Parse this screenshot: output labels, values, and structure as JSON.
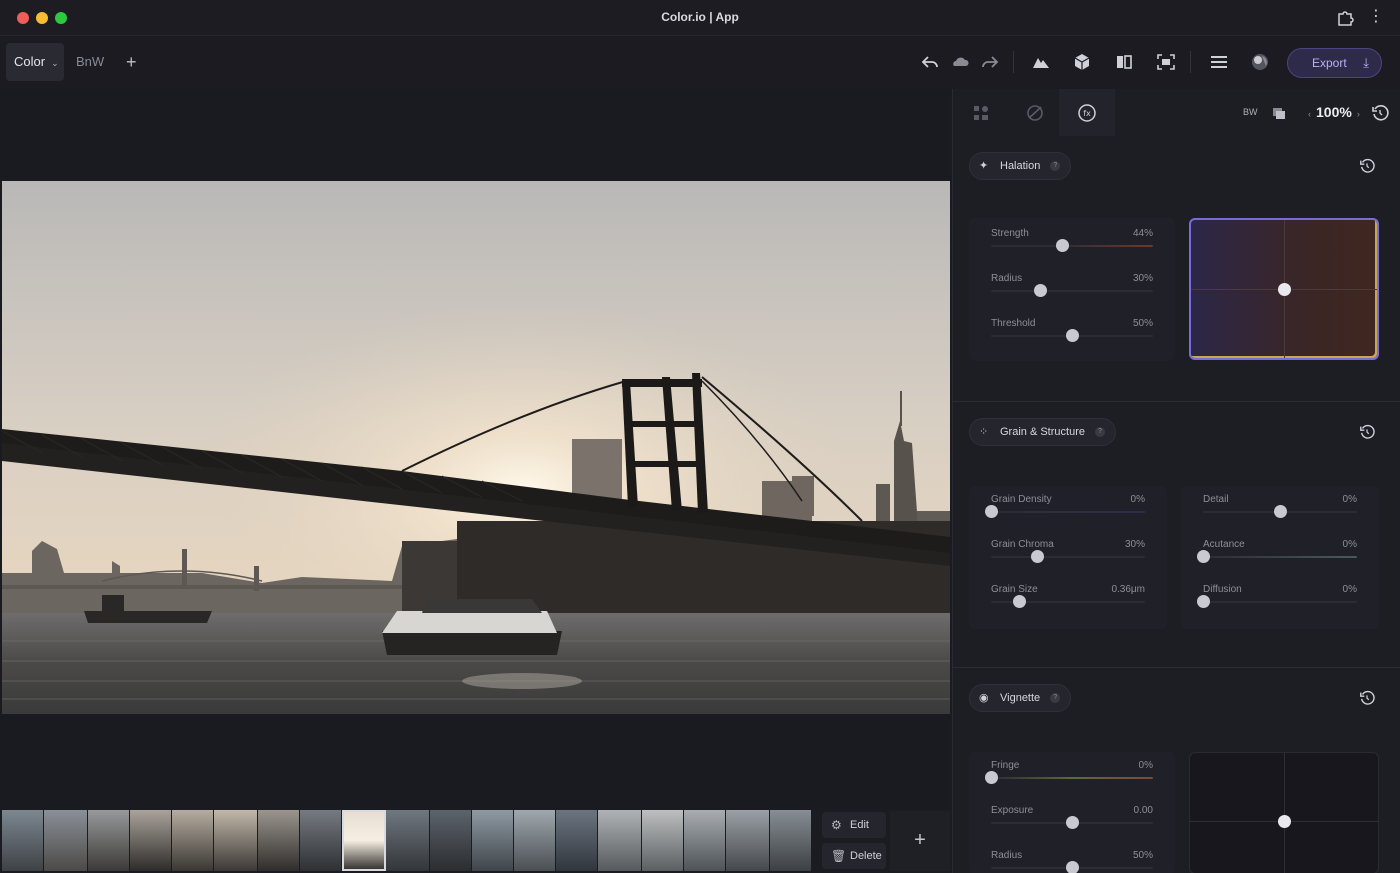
{
  "window": {
    "title": "Color.io | App"
  },
  "tabs": [
    {
      "label": "Color",
      "active": true
    },
    {
      "label": "BnW",
      "active": false
    }
  ],
  "toolbar": {
    "add_tab": "+",
    "export_label": "Export",
    "icons": [
      "undo-icon",
      "cloud-icon",
      "redo-icon",
      "histogram-icon",
      "cube-icon",
      "compare-icon",
      "fit-screen-icon",
      "menu-icon",
      "profile-icon"
    ]
  },
  "panel": {
    "bw_label": "BW",
    "zoom": "100%",
    "tabs": [
      "presets-icon",
      "curves-icon",
      "fx-icon"
    ],
    "sections": {
      "halation": {
        "title": "Halation",
        "help": "?",
        "sliders": [
          {
            "label": "Strength",
            "value_text": "44%",
            "value": 0.44
          },
          {
            "label": "Radius",
            "value_text": "30%",
            "value": 0.3
          },
          {
            "label": "Threshold",
            "value_text": "50%",
            "value": 0.5
          }
        ]
      },
      "grain": {
        "title": "Grain & Structure",
        "help": "?",
        "left_sliders": [
          {
            "label": "Grain Density",
            "value_text": "0%",
            "value": 0.0
          },
          {
            "label": "Grain Chroma",
            "value_text": "30%",
            "value": 0.3
          },
          {
            "label": "Grain Size",
            "value_text": "0.36μm",
            "value": 0.18
          }
        ],
        "right_sliders": [
          {
            "label": "Detail",
            "value_text": "0%",
            "value": 0.5
          },
          {
            "label": "Acutance",
            "value_text": "0%",
            "value": 0.0
          },
          {
            "label": "Diffusion",
            "value_text": "0%",
            "value": 0.0
          }
        ]
      },
      "vignette": {
        "title": "Vignette",
        "help": "?",
        "sliders": [
          {
            "label": "Fringe",
            "value_text": "0%",
            "value": 0.0
          },
          {
            "label": "Exposure",
            "value_text": "0.00",
            "value": 0.5
          },
          {
            "label": "Radius",
            "value_text": "50%",
            "value": 0.5
          }
        ]
      }
    }
  },
  "filmstrip": {
    "edit_label": "Edit",
    "delete_label": "Delete",
    "add_label": "+",
    "selected_index": 8
  },
  "colors": {
    "accent": "#6b5fd6",
    "export_text": "#b9b3f5"
  }
}
